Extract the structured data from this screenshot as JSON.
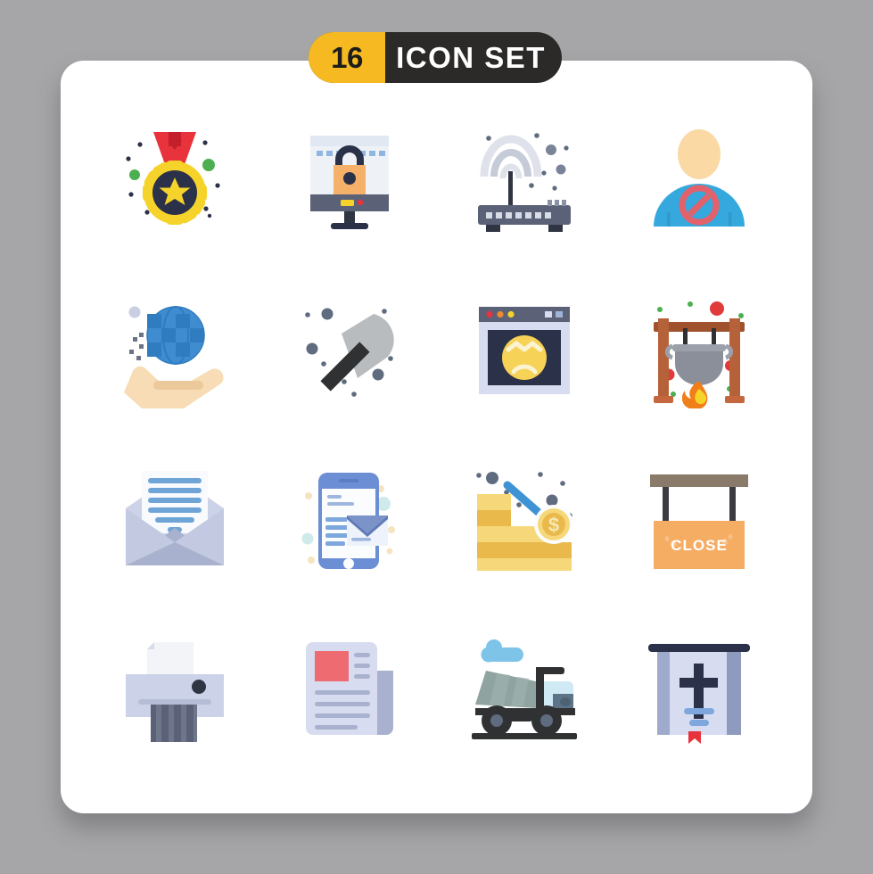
{
  "page": {
    "background_color": "#a6a6a8",
    "card_color": "#ffffff"
  },
  "badge": {
    "count": "16",
    "title": "ICON SET",
    "count_bg": "#f6b922",
    "title_bg": "#2b2a28",
    "count_color": "#1d1c1b",
    "title_color": "#ffffff"
  },
  "grid": {
    "columns": 4,
    "rows": 4,
    "total": 16
  },
  "icons": [
    {
      "index": 1,
      "name": "medal-award-icon",
      "label": "Medal",
      "colors": [
        "#e8323c",
        "#f6d32b",
        "#2b3148",
        "#4caf50"
      ]
    },
    {
      "index": 2,
      "name": "computer-lock-icon",
      "label": "Secure Computer",
      "colors": [
        "#e8eef5",
        "#f5b06a",
        "#2b3148",
        "#5b6277"
      ]
    },
    {
      "index": 3,
      "name": "wireless-router-icon",
      "label": "Router",
      "colors": [
        "#5b6277",
        "#c6cbd8",
        "#e4e7ee"
      ]
    },
    {
      "index": 4,
      "name": "blocked-user-icon",
      "label": "Blocked User",
      "colors": [
        "#fad9a5",
        "#35a8dd",
        "#e2616b"
      ]
    },
    {
      "index": 5,
      "name": "global-hand-icon",
      "label": "Global Service",
      "colors": [
        "#f7dcb5",
        "#2f7fc8",
        "#4a95d6"
      ]
    },
    {
      "index": 6,
      "name": "shovel-icon",
      "label": "Shovel",
      "colors": [
        "#b9bcbe",
        "#2f3133",
        "#5f6b7e"
      ]
    },
    {
      "index": 7,
      "name": "sad-browser-icon",
      "label": "Error Page",
      "colors": [
        "#d7dcf0",
        "#2b3148",
        "#f6d256"
      ]
    },
    {
      "index": 8,
      "name": "campfire-pot-icon",
      "label": "Camp Cooking",
      "colors": [
        "#a0522d",
        "#8a8f99",
        "#f07e19",
        "#e03a3a"
      ]
    },
    {
      "index": 9,
      "name": "open-mail-icon",
      "label": "Open Mail",
      "colors": [
        "#ccd2e8",
        "#ffffff",
        "#6fa5d6"
      ]
    },
    {
      "index": 10,
      "name": "mobile-mail-icon",
      "label": "Mobile Mail",
      "colors": [
        "#6c8ed4",
        "#ffffff",
        "#7ea8dd"
      ]
    },
    {
      "index": 11,
      "name": "money-loss-icon",
      "label": "Loss",
      "colors": [
        "#f6d87a",
        "#e9b94b",
        "#3e93d4"
      ]
    },
    {
      "index": 12,
      "name": "close-sign-icon",
      "label": "Close Sign",
      "colors": [
        "#8a7a6a",
        "#f5ac63",
        "#3b3b42"
      ]
    },
    {
      "index": 13,
      "name": "printer-icon",
      "label": "Printer",
      "colors": [
        "#ccd2e8",
        "#5b6277",
        "#f2f4f8"
      ]
    },
    {
      "index": 14,
      "name": "newspaper-icon",
      "label": "Newspaper",
      "colors": [
        "#d7dcf0",
        "#ee6b72",
        "#a8b2ce"
      ]
    },
    {
      "index": 15,
      "name": "dump-truck-icon",
      "label": "Dump Truck",
      "colors": [
        "#8fa3a0",
        "#2f3133",
        "#7ec3e8"
      ]
    },
    {
      "index": 16,
      "name": "religious-banner-icon",
      "label": "Scripture Banner",
      "colors": [
        "#d7dcf0",
        "#2b3148",
        "#e8323c"
      ]
    }
  ]
}
